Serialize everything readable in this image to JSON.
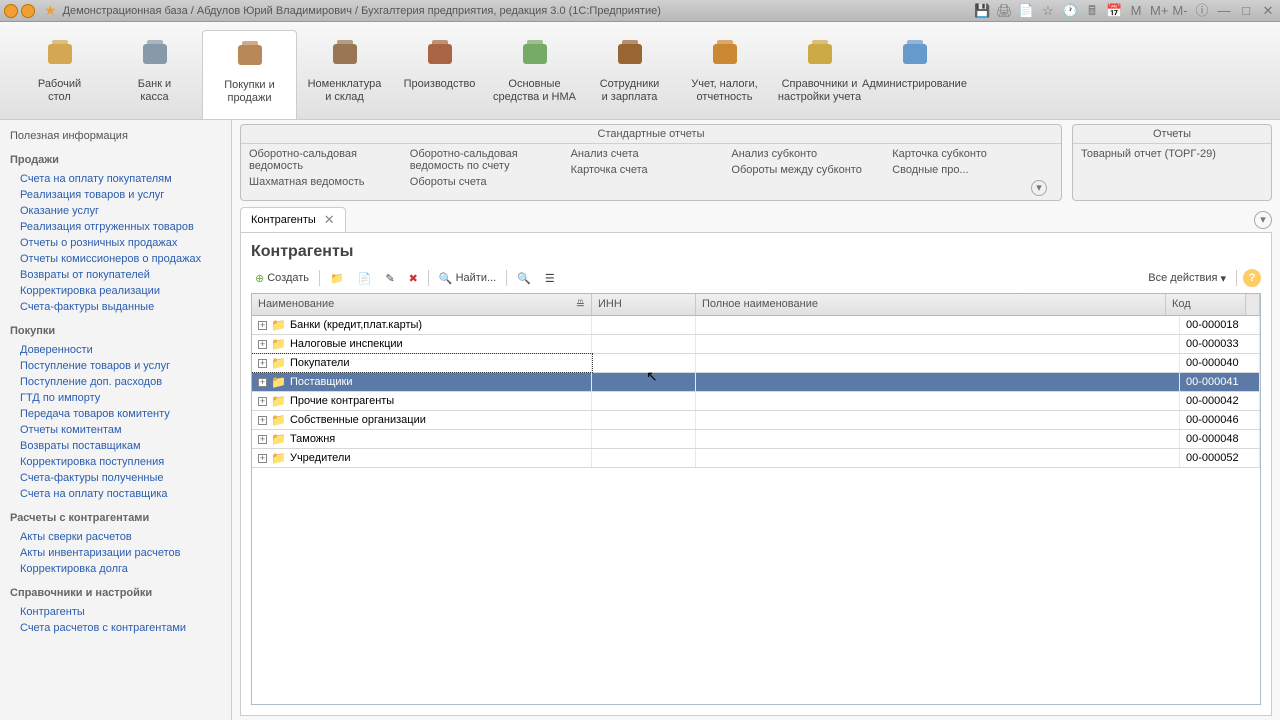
{
  "titlebar": {
    "text": "Демонстрационная база / Абдулов Юрий Владимирович / Бухгалтерия предприятия, редакция 3.0  (1С:Предприятие)"
  },
  "toolbar": [
    {
      "label": "Рабочий\nстол"
    },
    {
      "label": "Банк и\nкасса"
    },
    {
      "label": "Покупки и\nпродажи"
    },
    {
      "label": "Номенклатура\nи склад"
    },
    {
      "label": "Производство"
    },
    {
      "label": "Основные\nсредства и НМА"
    },
    {
      "label": "Сотрудники\nи зарплата"
    },
    {
      "label": "Учет, налоги,\nотчетность"
    },
    {
      "label": "Справочники и\nнастройки учета"
    },
    {
      "label": "Администрирование"
    }
  ],
  "sidebar": {
    "info": "Полезная информация",
    "groups": [
      {
        "title": "Продажи",
        "items": [
          "Счета на оплату покупателям",
          "Реализация товаров и услуг",
          "Оказание услуг",
          "Реализация отгруженных товаров",
          "Отчеты о розничных продажах",
          "Отчеты комиссионеров о продажах",
          "Возвраты от покупателей",
          "Корректировка реализации",
          "Счета-фактуры выданные"
        ]
      },
      {
        "title": "Покупки",
        "items": [
          "Доверенности",
          "Поступление товаров и услуг",
          "Поступление доп. расходов",
          "ГТД по импорту",
          "Передача товаров комитенту",
          "Отчеты комитентам",
          "Возвраты поставщикам",
          "Корректировка поступления",
          "Счета-фактуры полученные",
          "Счета на оплату поставщика"
        ]
      },
      {
        "title": "Расчеты с контрагентами",
        "items": [
          "Акты сверки расчетов",
          "Акты инвентаризации расчетов",
          "Корректировка долга"
        ]
      },
      {
        "title": "Справочники и настройки",
        "items": [
          "Контрагенты",
          "Счета расчетов с контрагентами"
        ]
      }
    ]
  },
  "reports": {
    "std_title": "Стандартные отчеты",
    "std_cols": [
      [
        "Оборотно-сальдовая ведомость",
        "Шахматная ведомость"
      ],
      [
        "Оборотно-сальдовая ведомость по счету",
        "Обороты счета"
      ],
      [
        "Анализ счета",
        "Карточка счета"
      ],
      [
        "Анализ субконто",
        "Обороты между субконто"
      ],
      [
        "Карточка субконто",
        "Сводные про..."
      ]
    ],
    "rep_title": "Отчеты",
    "rep_items": [
      "Товарный отчет (ТОРГ-29)"
    ]
  },
  "tab": {
    "label": "Контрагенты"
  },
  "page": {
    "title": "Контрагенты",
    "create": "Создать",
    "find": "Найти...",
    "all_actions": "Все действия"
  },
  "table": {
    "headers": {
      "name": "Наименование",
      "inn": "ИНН",
      "full": "Полное наименование",
      "code": "Код"
    },
    "rows": [
      {
        "name": "Банки (кредит,плат.карты)",
        "code": "00-000018"
      },
      {
        "name": "Налоговые инспекции",
        "code": "00-000033"
      },
      {
        "name": "Покупатели",
        "code": "00-000040"
      },
      {
        "name": "Поставщики",
        "code": "00-000041",
        "selected": true
      },
      {
        "name": "Прочие контрагенты",
        "code": "00-000042"
      },
      {
        "name": "Собственные организации",
        "code": "00-000046"
      },
      {
        "name": "Таможня",
        "code": "00-000048"
      },
      {
        "name": "Учредители",
        "code": "00-000052"
      }
    ]
  }
}
